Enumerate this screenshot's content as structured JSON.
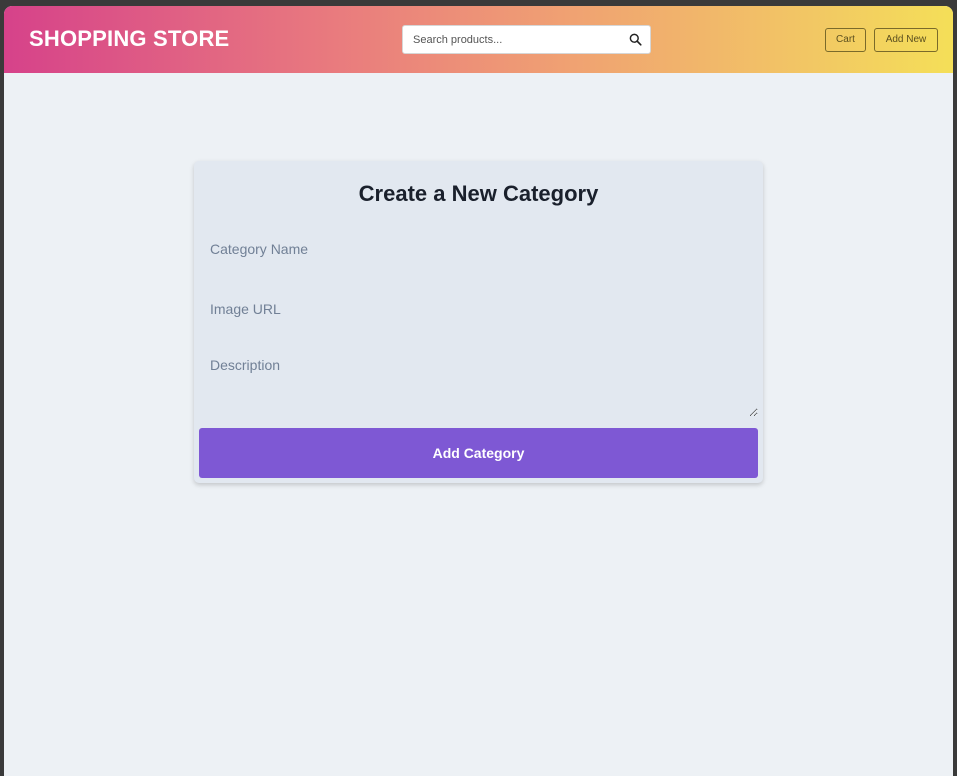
{
  "header": {
    "brand": "SHOPPING STORE",
    "search_placeholder": "Search products...",
    "search_icon": "search-icon",
    "cart_label": "Cart",
    "add_new_label": "Add New"
  },
  "form": {
    "title": "Create a New Category",
    "name_placeholder": "Category Name",
    "image_url_placeholder": "Image URL",
    "description_placeholder": "Description",
    "submit_label": "Add Category"
  },
  "colors": {
    "header_gradient_start": "#d6428a",
    "header_gradient_end": "#f4df58",
    "page_background": "#edf1f5",
    "card_background": "#e2e8f0",
    "submit_button": "#7e58d4"
  }
}
